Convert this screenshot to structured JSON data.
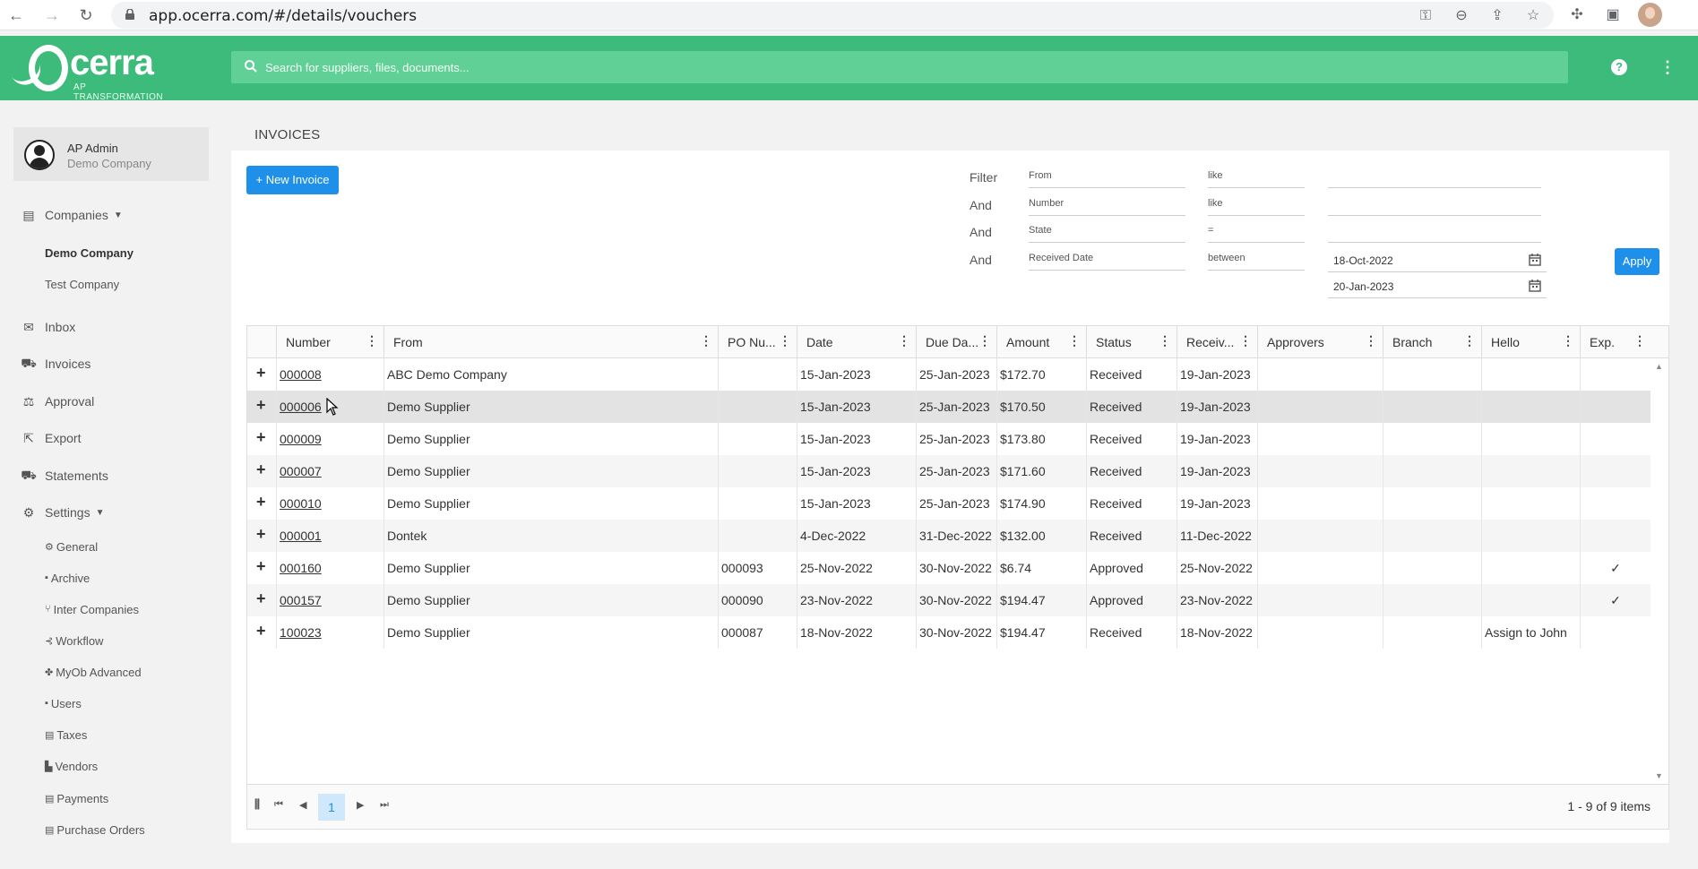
{
  "browser": {
    "url": "app.ocerra.com/#/details/vouchers"
  },
  "header": {
    "logo_text": "cerra",
    "logo_subtitle": "AP TRANSFORMATION",
    "search_placeholder": "Search for suppliers, files, documents...",
    "help_label": "?",
    "brand_color": "#3dbb7a"
  },
  "user": {
    "name": "AP Admin",
    "company": "Demo Company"
  },
  "sidebar": {
    "companies_label": "Companies",
    "companies": [
      "Demo Company",
      "Test Company"
    ],
    "items": [
      {
        "label": "Inbox",
        "icon": "inbox-icon"
      },
      {
        "label": "Invoices",
        "icon": "basket-icon"
      },
      {
        "label": "Approval",
        "icon": "approval-icon"
      },
      {
        "label": "Export",
        "icon": "export-icon"
      },
      {
        "label": "Statements",
        "icon": "basket-icon"
      }
    ],
    "settings_label": "Settings",
    "settings_items": [
      "General",
      "Archive",
      "Inter Companies",
      "Workflow",
      "MyOb Advanced",
      "Users",
      "Taxes",
      "Vendors",
      "Payments",
      "Purchase Orders"
    ]
  },
  "page": {
    "title": "INVOICES",
    "new_button": "+ New Invoice",
    "apply_button": "Apply"
  },
  "filters": [
    {
      "conj": "Filter",
      "field": "From",
      "op": "like",
      "value": ""
    },
    {
      "conj": "And",
      "field": "Number",
      "op": "like",
      "value": ""
    },
    {
      "conj": "And",
      "field": "State",
      "op": "=",
      "value": ""
    },
    {
      "conj": "And",
      "field": "Received Date",
      "op": "between",
      "value": ""
    }
  ],
  "date_range": {
    "from": "18-Oct-2022",
    "to": "20-Jan-2023"
  },
  "grid": {
    "columns": [
      "Number",
      "From",
      "PO Nu...",
      "Date",
      "Due Da...",
      "Amount",
      "Status",
      "Receiv...",
      "Approvers",
      "Branch",
      "Hello",
      "Exp."
    ],
    "rows": [
      {
        "number": "000008",
        "from": "ABC Demo Company",
        "po": "",
        "date": "15-Jan-2023",
        "due": "25-Jan-2023",
        "amount": "$172.70",
        "status": "Received",
        "received": "19-Jan-2023",
        "approvers": "",
        "branch": "",
        "hello": "",
        "exp": ""
      },
      {
        "number": "000006",
        "from": "Demo Supplier",
        "po": "",
        "date": "15-Jan-2023",
        "due": "25-Jan-2023",
        "amount": "$170.50",
        "status": "Received",
        "received": "19-Jan-2023",
        "approvers": "",
        "branch": "",
        "hello": "",
        "exp": ""
      },
      {
        "number": "000009",
        "from": "Demo Supplier",
        "po": "",
        "date": "15-Jan-2023",
        "due": "25-Jan-2023",
        "amount": "$173.80",
        "status": "Received",
        "received": "19-Jan-2023",
        "approvers": "",
        "branch": "",
        "hello": "",
        "exp": ""
      },
      {
        "number": "000007",
        "from": "Demo Supplier",
        "po": "",
        "date": "15-Jan-2023",
        "due": "25-Jan-2023",
        "amount": "$171.60",
        "status": "Received",
        "received": "19-Jan-2023",
        "approvers": "",
        "branch": "",
        "hello": "",
        "exp": ""
      },
      {
        "number": "000010",
        "from": "Demo Supplier",
        "po": "",
        "date": "15-Jan-2023",
        "due": "25-Jan-2023",
        "amount": "$174.90",
        "status": "Received",
        "received": "19-Jan-2023",
        "approvers": "",
        "branch": "",
        "hello": "",
        "exp": ""
      },
      {
        "number": "000001",
        "from": "Dontek",
        "po": "",
        "date": "4-Dec-2022",
        "due": "31-Dec-2022",
        "amount": "$132.00",
        "status": "Received",
        "received": "11-Dec-2022",
        "approvers": "",
        "branch": "",
        "hello": "",
        "exp": ""
      },
      {
        "number": "000160",
        "from": "Demo Supplier",
        "po": "000093",
        "date": "25-Nov-2022",
        "due": "30-Nov-2022",
        "amount": "$6.74",
        "status": "Approved",
        "received": "25-Nov-2022",
        "approvers": "",
        "branch": "",
        "hello": "",
        "exp": "✓"
      },
      {
        "number": "000157",
        "from": "Demo Supplier",
        "po": "000090",
        "date": "23-Nov-2022",
        "due": "30-Nov-2022",
        "amount": "$194.47",
        "status": "Approved",
        "received": "23-Nov-2022",
        "approvers": "",
        "branch": "",
        "hello": "",
        "exp": "✓"
      },
      {
        "number": "100023",
        "from": "Demo Supplier",
        "po": "000087",
        "date": "18-Nov-2022",
        "due": "30-Nov-2022",
        "amount": "$194.47",
        "status": "Received",
        "received": "18-Nov-2022",
        "approvers": "",
        "branch": "",
        "hello": "Assign to John",
        "exp": ""
      }
    ]
  },
  "pager": {
    "current_page": "1",
    "info": "1 - 9 of 9 items"
  }
}
